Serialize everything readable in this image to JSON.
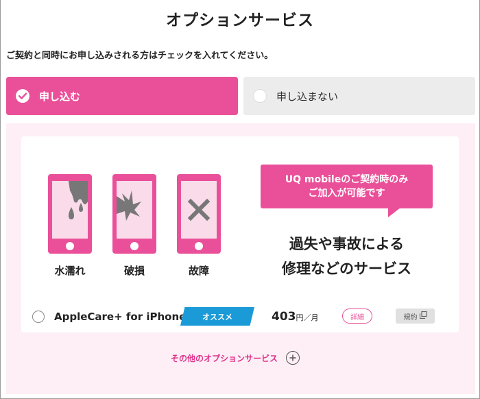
{
  "page": {
    "title": "オプションサービス",
    "instruction": "ご契約と同時にお申し込みされる方はチェックを入れてください。"
  },
  "choices": {
    "apply_label": "申し込む",
    "no_label": "申し込まない",
    "selected": "apply"
  },
  "features": [
    {
      "label": "水濡れ",
      "icon": "water-damage-icon"
    },
    {
      "label": "破損",
      "icon": "breakage-icon"
    },
    {
      "label": "故障",
      "icon": "malfunction-icon"
    }
  ],
  "bubble": {
    "line1": "UQ mobileのご契約時のみ",
    "line2": "ご加入が可能です"
  },
  "headline": {
    "line1": "過失や事故による",
    "line2": "修理などのサービス"
  },
  "service": {
    "name": "AppleCare+ for iPhone",
    "badge": "オススメ",
    "price": "403",
    "price_unit": "円／月",
    "detail_label": "詳細",
    "terms_label": "規約"
  },
  "other_link": "その他のオプションサービス",
  "colors": {
    "accent": "#ea5099",
    "badge": "#1a9ad6",
    "panel_bg": "#fdeff5"
  }
}
